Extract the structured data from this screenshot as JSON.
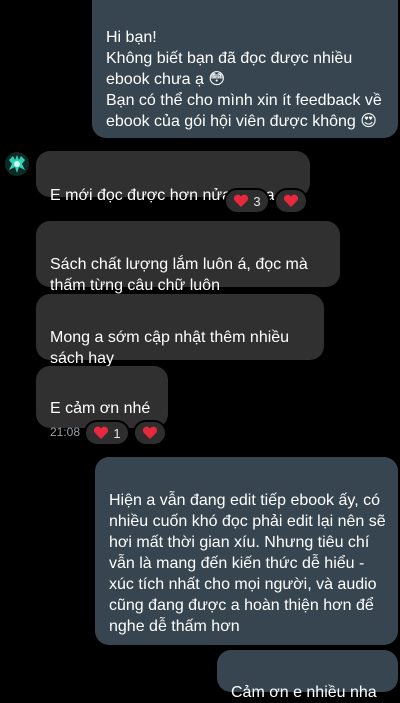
{
  "conversation": {
    "messages": [
      {
        "id": "m1",
        "direction": "outgoing",
        "text": "Hi bạn!\nKhông biết bạn đã đọc được nhiều ebook chưa ạ 😳\nBạn có thể cho mình xin ít feedback về ebook của gói hội viên được không 😍"
      },
      {
        "id": "m2",
        "direction": "incoming",
        "text": "E mới đọc được hơn nửa thôi a ạ"
      },
      {
        "id": "m3",
        "direction": "incoming",
        "text": "Sách chất lượng lắm luôn á, đọc mà thấm từng câu chữ luôn"
      },
      {
        "id": "m4",
        "direction": "incoming",
        "text": "Mong a sớm cập nhật thêm nhiều sách hay"
      },
      {
        "id": "m5",
        "direction": "incoming",
        "text": "E cảm ơn nhé",
        "time": "21:08"
      },
      {
        "id": "m6",
        "direction": "outgoing",
        "text": "Hiện a vẫn đang edit tiếp ebook ấy, có nhiều cuốn khó đọc phải edit lại nên sẽ hơi mất thời gian xíu. Nhưng tiêu chí vẫn là mang đến kiến thức dễ hiểu - xúc tích nhất cho mọi người, và audio cũng đang được a hoàn thiện hơn để nghe dễ thấm hơn"
      },
      {
        "id": "m7",
        "direction": "outgoing",
        "text": "Cảm ơn e nhiều nha"
      }
    ],
    "reactions": {
      "m2": {
        "count": "3"
      },
      "m5": {
        "count": "1"
      }
    }
  },
  "colors": {
    "background": "#000000",
    "outgoing_bubble": "#36454f",
    "incoming_bubble": "#303030",
    "heart": "#e8283c"
  },
  "icons": [
    "avatar",
    "heart-icon"
  ]
}
